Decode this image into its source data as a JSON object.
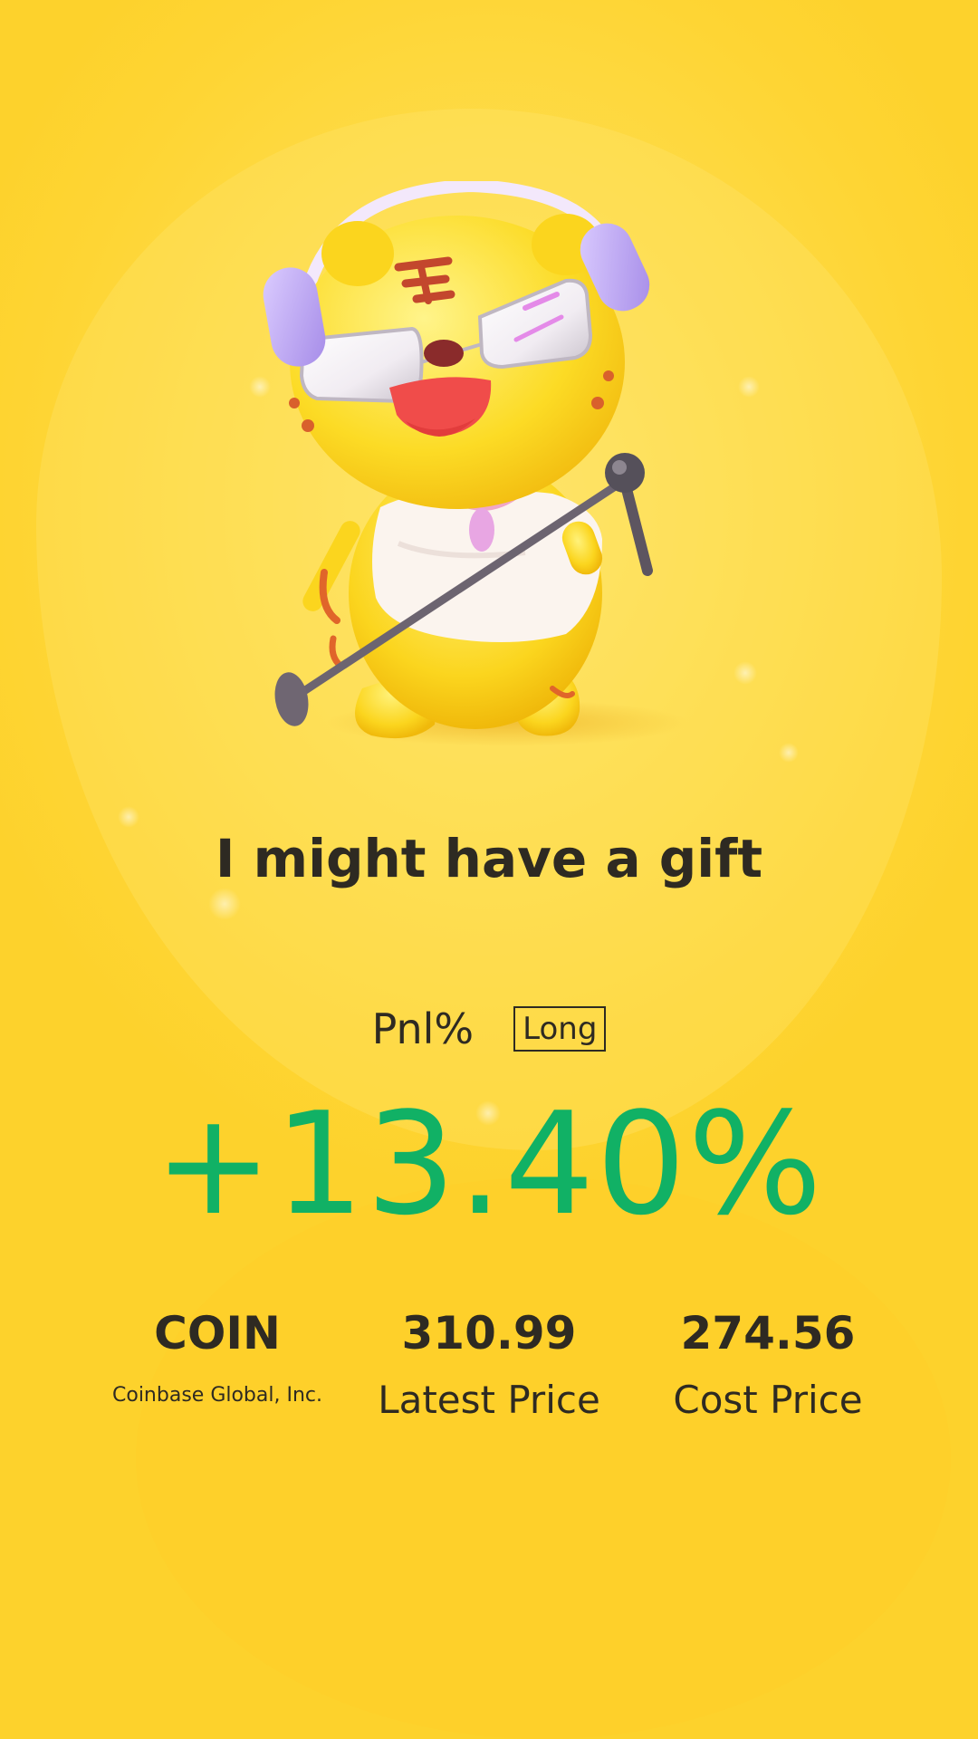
{
  "mascot": {
    "icon": "tiger-mascot-illustration"
  },
  "headline": "I might have a gift",
  "pnl": {
    "label": "Pnl%",
    "direction": "Long",
    "value": "+13.40%",
    "value_color": "#11b165"
  },
  "stats": {
    "symbol": "COIN",
    "company": "Coinbase Global, Inc.",
    "latest_price": "310.99",
    "latest_price_label": "Latest Price",
    "cost_price": "274.56",
    "cost_price_label": "Cost Price"
  },
  "colors": {
    "background": "#fdd83c",
    "text": "#2e2a22"
  }
}
